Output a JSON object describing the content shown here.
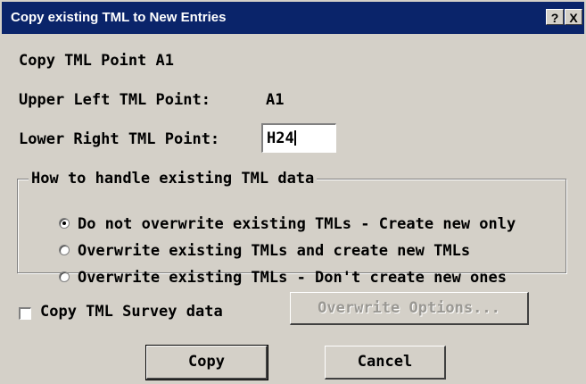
{
  "window": {
    "title": "Copy existing TML to New Entries",
    "help_button": "?",
    "close_button": "X"
  },
  "info": {
    "copy_point_label": "Copy TML Point A1",
    "upper_left_label": "Upper Left TML Point:",
    "upper_left_value": "A1",
    "lower_right_label": "Lower Right TML Point:",
    "lower_right_value": "H24"
  },
  "group": {
    "legend": "How to handle existing TML data",
    "options": [
      {
        "label": "Do not overwrite existing TMLs - Create new only",
        "selected": true
      },
      {
        "label": "Overwrite existing TMLs and create new TMLs",
        "selected": false
      },
      {
        "label": "Overwrite existing TMLs - Don't create new ones",
        "selected": false
      }
    ]
  },
  "survey": {
    "checkbox_label": "Copy TML Survey data",
    "checked": false,
    "overwrite_options_label": "Overwrite Options...",
    "overwrite_options_enabled": false
  },
  "buttons": {
    "copy": "Copy",
    "cancel": "Cancel"
  }
}
